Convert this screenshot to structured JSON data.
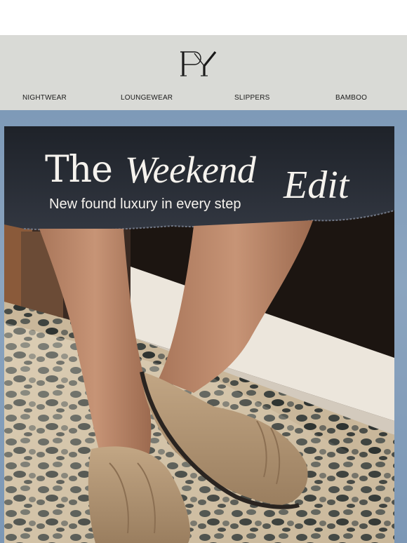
{
  "brand": {
    "logo_text": "PY"
  },
  "nav": {
    "items": [
      {
        "label": "NIGHTWEAR"
      },
      {
        "label": "LOUNGEWEAR"
      },
      {
        "label": "SLIPPERS"
      },
      {
        "label": "BAMBOO"
      }
    ]
  },
  "hero": {
    "headline_the": "The",
    "headline_weekend": "Weekend",
    "headline_edit": "Edit",
    "subline": "New found luxury in every step"
  },
  "colors": {
    "header_bg": "#d9dad6",
    "frame_bg": "#8ba4bf",
    "headline_text": "#f6f3ee"
  }
}
